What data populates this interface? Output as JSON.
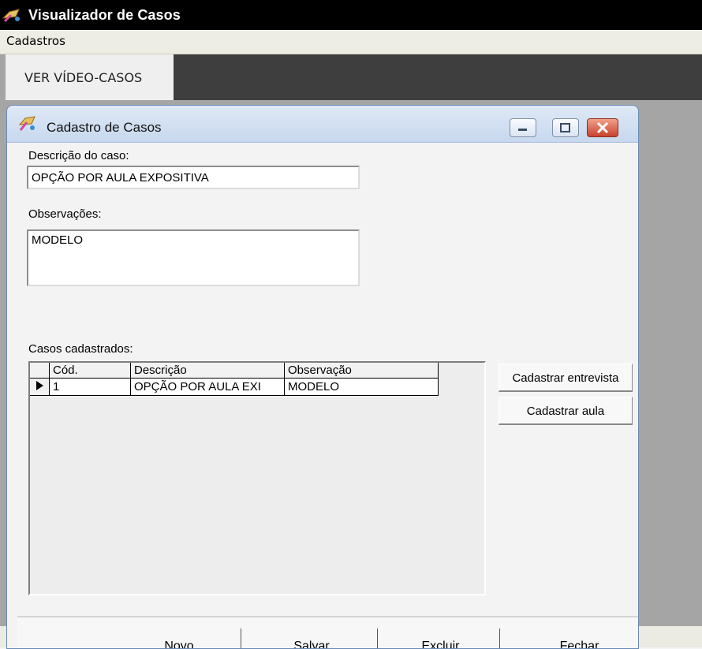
{
  "app": {
    "title": "Visualizador de Casos",
    "menu": [
      "Cadastros"
    ],
    "tab_label": "VER VÍDEO-CASOS"
  },
  "window": {
    "title": "Cadastro de Casos",
    "descricao_label": "Descrição do caso:",
    "descricao_value": "OPÇÃO POR AULA EXPOSITIVA",
    "observacoes_label": "Observações:",
    "observacoes_value": "MODELO",
    "casos_label": "Casos cadastrados:",
    "grid": {
      "columns": [
        "Cód.",
        "Descrição",
        "Observação"
      ],
      "rows": [
        {
          "cod": "1",
          "descricao": "OPÇÃO POR AULA EXI",
          "observacao": "MODELO"
        }
      ]
    },
    "side_buttons": [
      "Cadastrar entrevista",
      "Cadastrar aula"
    ],
    "footer_buttons": [
      "Novo",
      "Salvar",
      "Excluir",
      "Fechar"
    ]
  },
  "colors": {
    "titlebar": "#000000",
    "mdi_background": "#a5a5a5",
    "window_frame": "#6a8bb5",
    "close_button": "#c8422d"
  }
}
